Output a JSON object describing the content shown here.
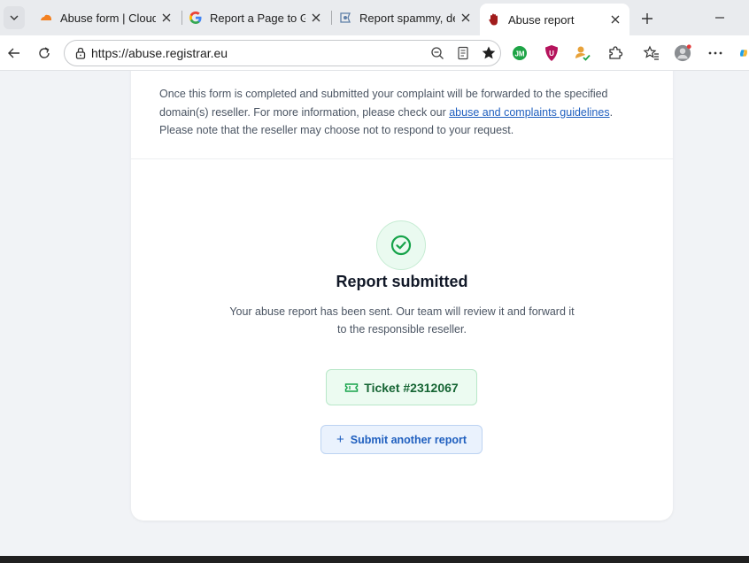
{
  "browser": {
    "tabs": [
      {
        "title": "Abuse form | Cloudfla",
        "icon": "cloudflare-icon",
        "active": false
      },
      {
        "title": "Report a Page to Goo",
        "icon": "google-icon",
        "active": false
      },
      {
        "title": "Report spammy, dece",
        "icon": "report-icon",
        "active": false
      },
      {
        "title": "Abuse report",
        "icon": "hand-icon",
        "active": true
      }
    ],
    "url": "https://abuse.registrar.eu"
  },
  "page": {
    "intro_before_link": "Once this form is completed and submitted your complaint will be forwarded to the specified domain(s) reseller. For more information, please check our ",
    "intro_link": "abuse and complaints guidelines",
    "intro_after_link": ".",
    "intro_note": "Please note that the reseller may choose not to respond to your request.",
    "heading": "Report submitted",
    "description": "Your abuse report has been sent. Our team will review it and forward it to the responsible reseller.",
    "ticket_label": "Ticket #2312067",
    "submit_another_label": "Submit another report",
    "submit_plus": "+"
  },
  "colors": {
    "success": "#16a34a",
    "link": "#1f5fbf",
    "accent_bg": "#eaf2fd"
  }
}
